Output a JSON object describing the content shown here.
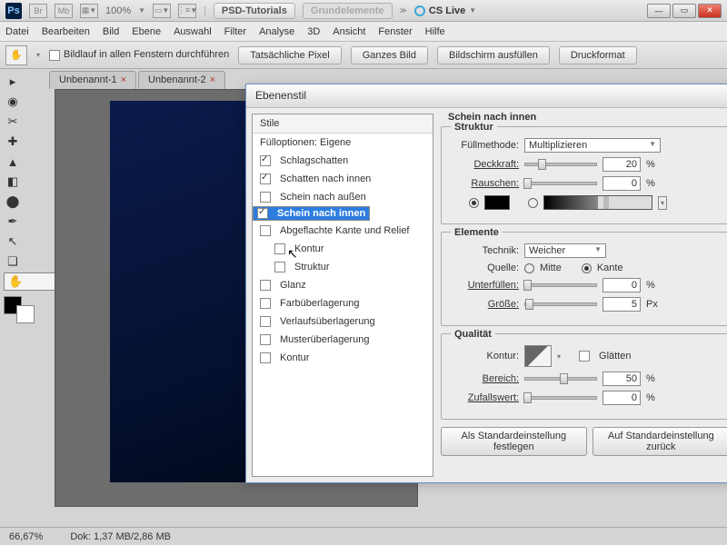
{
  "topbar": {
    "zoom": "100%",
    "btn1": "PSD-Tutorials",
    "btn2": "Grundelemente",
    "cslive": "CS Live"
  },
  "menu": [
    "Datei",
    "Bearbeiten",
    "Bild",
    "Ebene",
    "Auswahl",
    "Filter",
    "Analyse",
    "3D",
    "Ansicht",
    "Fenster",
    "Hilfe"
  ],
  "optbar": {
    "scrollall": "Bildlauf in allen Fenstern durchführen",
    "b1": "Tatsächliche Pixel",
    "b2": "Ganzes Bild",
    "b3": "Bildschirm ausfüllen",
    "b4": "Druckformat"
  },
  "tabs": [
    {
      "name": "Unbenannt-1",
      "close": "×"
    },
    {
      "name": "Unbenannt-2",
      "close": "×"
    }
  ],
  "status": {
    "zoom": "66,67%",
    "doc": "Dok: 1,37 MB/2,86 MB"
  },
  "dialog": {
    "title": "Ebenenstil",
    "styles_hdr": "Stile",
    "fill": "Fülloptionen: Eigene",
    "items": [
      {
        "label": "Schlagschatten",
        "checked": true
      },
      {
        "label": "Schatten nach innen",
        "checked": true
      },
      {
        "label": "Schein nach außen",
        "checked": false
      },
      {
        "label": "Schein nach innen",
        "checked": true,
        "selected": true
      },
      {
        "label": "Abgeflachte Kante und Relief",
        "checked": false
      },
      {
        "label": "Kontur",
        "checked": false,
        "sub": true
      },
      {
        "label": "Struktur",
        "checked": false,
        "sub": true
      },
      {
        "label": "Glanz",
        "checked": false
      },
      {
        "label": "Farbüberlagerung",
        "checked": false
      },
      {
        "label": "Verlaufsüberlagerung",
        "checked": false
      },
      {
        "label": "Musterüberlagerung",
        "checked": false
      },
      {
        "label": "Kontur",
        "checked": false
      }
    ],
    "panel_title": "Schein nach innen",
    "struktur": {
      "legend": "Struktur",
      "blend_lbl": "Füllmethode:",
      "blend": "Multiplizieren",
      "opacity_lbl": "Deckkraft:",
      "opacity": "20",
      "pct": "%",
      "noise_lbl": "Rauschen:",
      "noise": "0"
    },
    "elemente": {
      "legend": "Elemente",
      "tech_lbl": "Technik:",
      "tech": "Weicher",
      "src_lbl": "Quelle:",
      "mitte": "Mitte",
      "kante": "Kante",
      "choke_lbl": "Unterfüllen:",
      "choke": "0",
      "size_lbl": "Größe:",
      "size": "5",
      "px": "Px"
    },
    "qualitat": {
      "legend": "Qualität",
      "contour_lbl": "Kontur:",
      "antialias": "Glätten",
      "range_lbl": "Bereich:",
      "range": "50",
      "jitter_lbl": "Zufallswert:",
      "jitter": "0"
    },
    "btns": {
      "def": "Als Standardeinstellung festlegen",
      "reset": "Auf Standardeinstellung zurück"
    }
  }
}
